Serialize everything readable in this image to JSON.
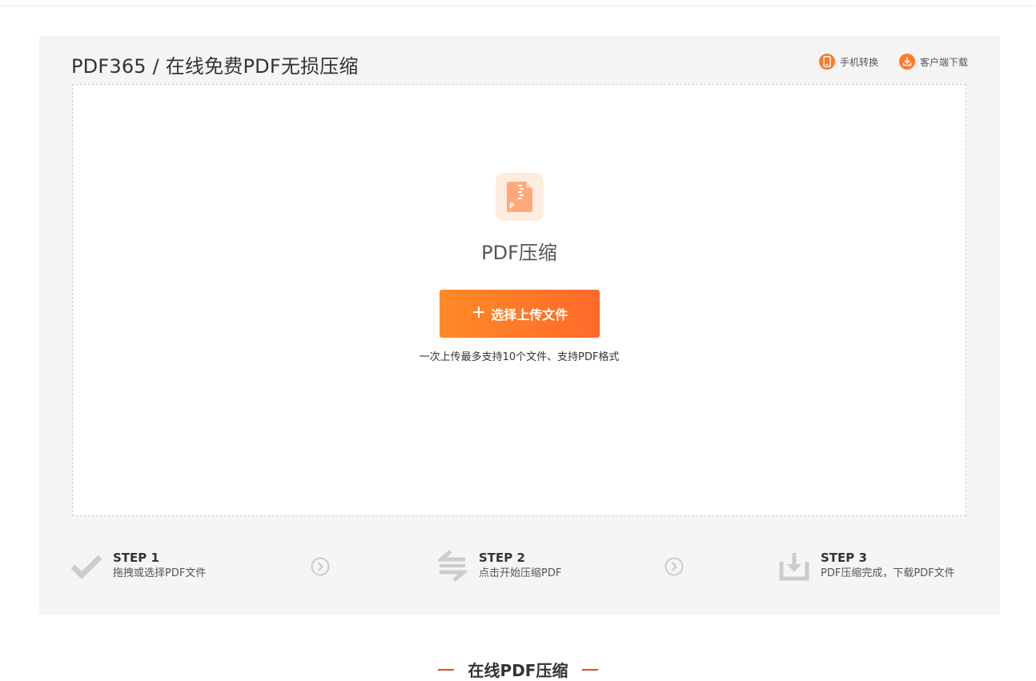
{
  "header": {
    "title": "PDF365 / 在线免费PDF无损压缩",
    "links": [
      {
        "label": "手机转换",
        "icon": "mobile-icon"
      },
      {
        "label": "客户端下载",
        "icon": "download-icon"
      }
    ]
  },
  "upload": {
    "file_icon": "pdf-compress-file-icon",
    "tool_name": "PDF压缩",
    "button_label": "选择上传文件",
    "hint": "一次上传最多支持10个文件、支持PDF格式"
  },
  "steps": [
    {
      "title": "STEP 1",
      "desc": "拖拽或选择PDF文件",
      "icon": "checkmark-icon"
    },
    {
      "title": "STEP 2",
      "desc": "点击开始压缩PDF",
      "icon": "convert-arrows-icon"
    },
    {
      "title": "STEP 3",
      "desc": "PDF压缩完成，下载PDF文件",
      "icon": "download-tray-icon"
    }
  ],
  "section": {
    "title": "在线PDF压缩"
  },
  "colors": {
    "accent": "#ff7a2a",
    "panel_bg": "#f5f5f5",
    "section_line": "#e8492a",
    "step_icon_gray": "#cccccc"
  }
}
